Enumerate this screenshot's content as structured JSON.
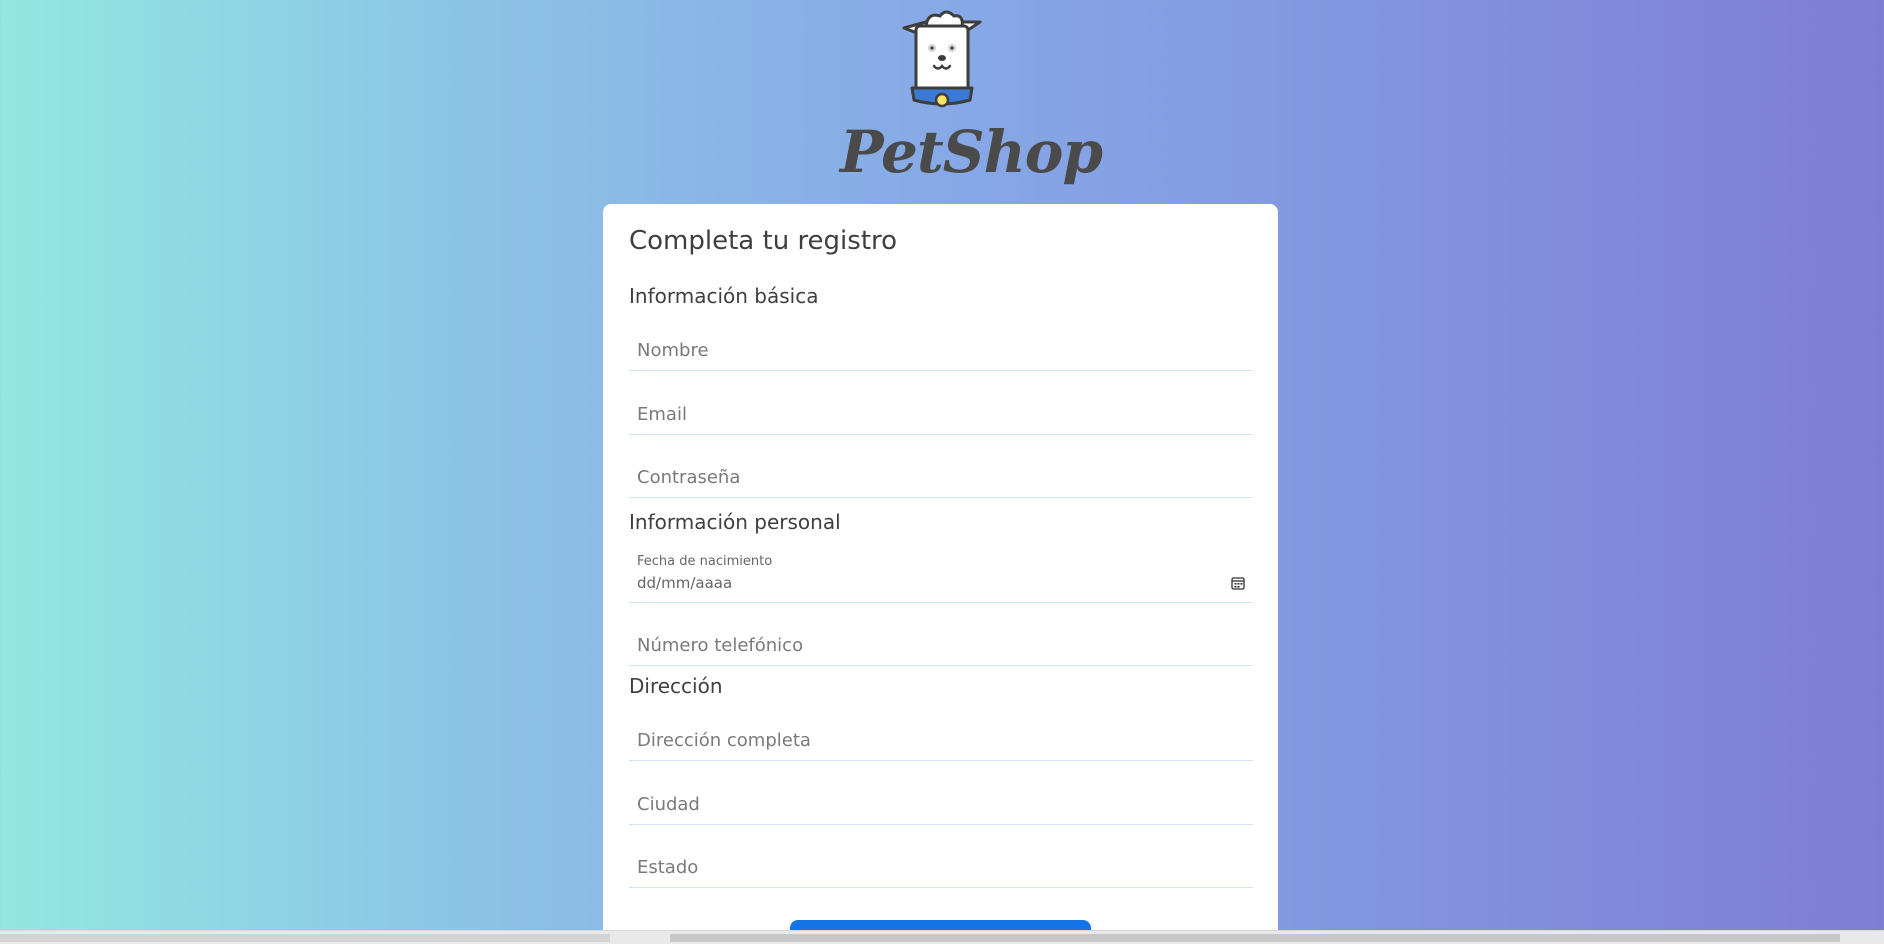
{
  "brand": {
    "name": "PetShop"
  },
  "form": {
    "title": "Completa tu registro",
    "sections": {
      "basic": "Información básica",
      "personal": "Información personal",
      "address": "Dirección"
    },
    "fields": {
      "nombre": {
        "placeholder": "Nombre"
      },
      "email": {
        "placeholder": "Email"
      },
      "password": {
        "placeholder": "Contraseña"
      },
      "birthdate": {
        "label": "Fecha de nacimiento",
        "placeholder": "dd/mm/aaaa"
      },
      "phone": {
        "placeholder": "Número telefónico"
      },
      "address_full": {
        "placeholder": "Dirección completa"
      },
      "city": {
        "placeholder": "Ciudad"
      },
      "state": {
        "placeholder": "Estado"
      }
    },
    "icons": {
      "calendar": "calendar-icon",
      "logo": "dog-logo-icon"
    }
  },
  "colors": {
    "gradient_start": "#92e8e1",
    "gradient_end": "#7e7dd6",
    "primary_button": "#1374e8",
    "brand_text": "#4a4a4a",
    "field_underline": "#cfe6f3"
  }
}
